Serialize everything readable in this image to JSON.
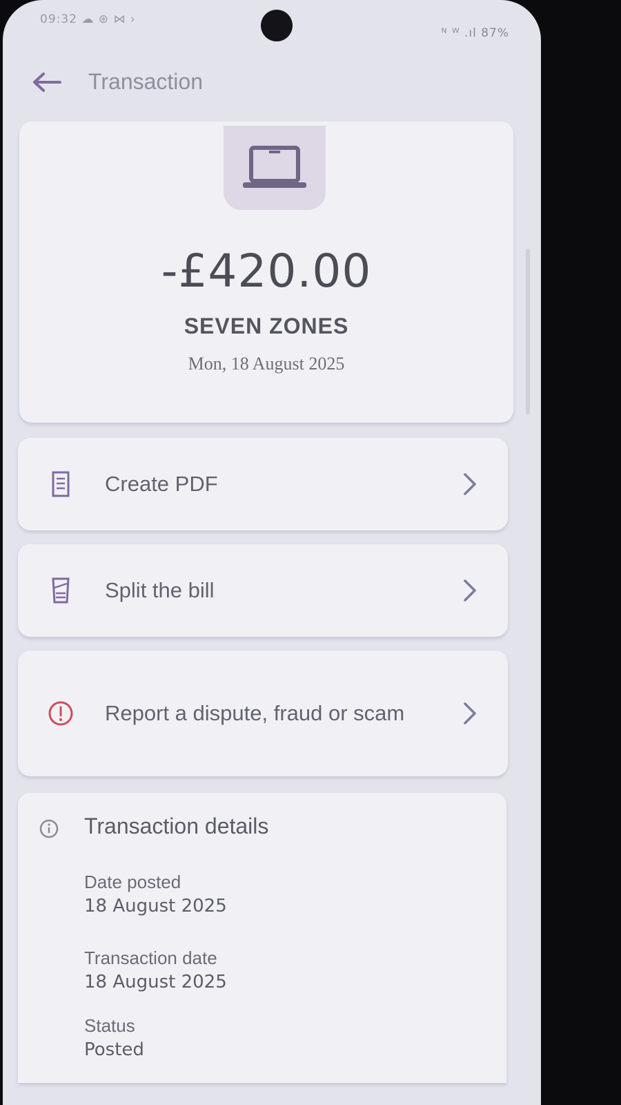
{
  "status_bar": {
    "left_text": "09:32 ☁ ⊛ ⋈ ›",
    "right_text": "ᴺ ᵂ .ıl 87%"
  },
  "header": {
    "back_icon": "arrow-left-icon",
    "title": "Transaction"
  },
  "transaction": {
    "icon": "laptop-icon",
    "amount": "-£420.00",
    "merchant": "SEVEN ZONES",
    "date": "Mon, 18 August 2025"
  },
  "actions": [
    {
      "label": "Create PDF",
      "icon": "receipt-icon"
    },
    {
      "label": "Split the bill",
      "icon": "split-receipt-icon"
    },
    {
      "label": "Report a dispute, fraud or scam",
      "icon": "alert-circle-icon"
    }
  ],
  "details": {
    "title": "Transaction details",
    "icon": "info-icon",
    "rows": [
      {
        "label": "Date posted",
        "value": "18 August 2025"
      },
      {
        "label": "Transaction date",
        "value": "18 August 2025"
      },
      {
        "label": "Status",
        "value": "Posted"
      }
    ]
  },
  "colors": {
    "background": "#e3e3ec",
    "card": "#f1f1f5",
    "accent_purple": "#7d6ba0",
    "alert_red": "#d24a5c"
  }
}
